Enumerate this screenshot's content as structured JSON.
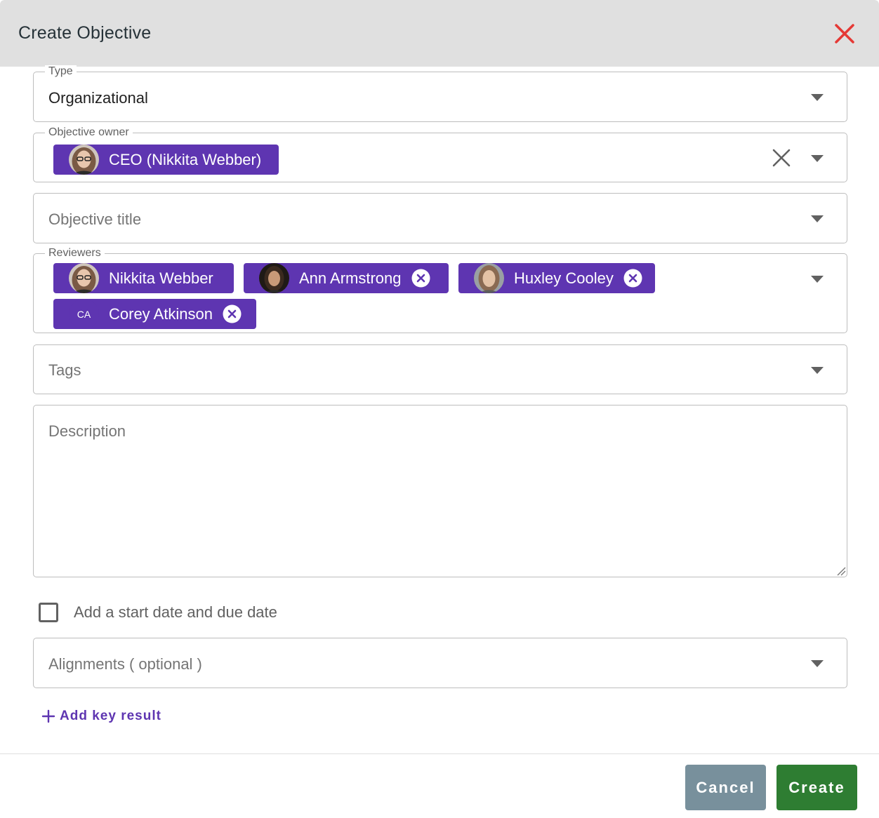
{
  "dialog": {
    "title": "Create Objective",
    "close_icon": "close-icon",
    "accent_close": "#e53935"
  },
  "type_field": {
    "label": "Type",
    "value": "Organizational"
  },
  "owner_field": {
    "label": "Objective owner",
    "chip": "CEO (Nikkita Webber)"
  },
  "title_field": {
    "placeholder": "Objective title"
  },
  "reviewers_field": {
    "label": "Reviewers",
    "chips": [
      {
        "name": "Nikkita Webber",
        "avatar": "photo",
        "removable": false
      },
      {
        "name": "Ann Armstrong",
        "avatar": "photo",
        "removable": true
      },
      {
        "name": "Huxley Cooley",
        "avatar": "photo",
        "removable": true
      },
      {
        "name": "Corey Atkinson",
        "avatar": "CA",
        "removable": true
      }
    ]
  },
  "tags_field": {
    "placeholder": "Tags"
  },
  "description_field": {
    "placeholder": "Description"
  },
  "dates_checkbox": {
    "label": "Add a start date and due date",
    "checked": false
  },
  "alignments_field": {
    "placeholder": "Alignments ( optional )"
  },
  "add_key_result": {
    "label": "Add key result"
  },
  "footer": {
    "cancel_label": "Cancel",
    "create_label": "Create"
  },
  "colors": {
    "chip": "#5e35b1",
    "create": "#2e7d32",
    "cancel": "#78909c",
    "header": "#e0e0e0"
  }
}
